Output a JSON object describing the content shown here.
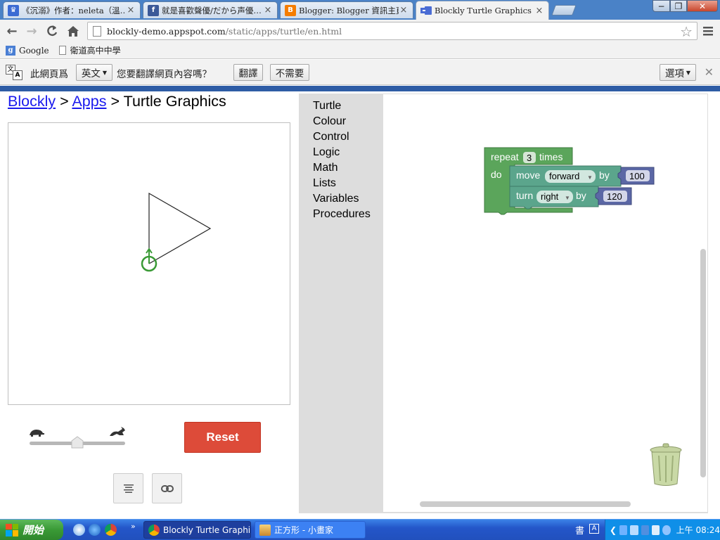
{
  "browser": {
    "tabs": [
      {
        "title": "《沉溺》作者：neleta（溫…",
        "icon": "ts-icon",
        "color": "#3b6bd3"
      },
      {
        "title": "就是喜歡聲優/だから声優…",
        "icon": "facebook-icon",
        "color": "#3b5998"
      },
      {
        "title": "Blogger: Blogger 資訊主頁",
        "icon": "blogger-icon",
        "color": "#f57d00"
      },
      {
        "title": "Blockly Turtle Graphics",
        "icon": "blockly-icon",
        "color": "#4a6cd4"
      }
    ],
    "window_controls": {
      "minimize": "−",
      "restore": "❐",
      "close": "✕"
    },
    "url_host": "blockly-demo.appspot.com",
    "url_path": "/static/apps/turtle/en.html",
    "bookmarks": [
      {
        "label": "Google",
        "icon": "google-icon"
      },
      {
        "label": "衛道高中中學",
        "icon": "page-icon"
      }
    ],
    "translate_bar": {
      "prefix": "此網頁爲",
      "language": "英文",
      "question": "您要翻譯網頁內容嗎？",
      "translate_button": "翻譯",
      "nope_button": "不需要",
      "options_button": "選項"
    }
  },
  "page": {
    "breadcrumb": {
      "blockly": "Blockly",
      "sep1": ">",
      "apps": "Apps",
      "sep2": ">",
      "current": "Turtle Graphics"
    },
    "reset_label": "Reset",
    "reset_color": "#dd4b39",
    "speed": {
      "value": 0.5
    }
  },
  "toolbox": [
    "Turtle",
    "Colour",
    "Control",
    "Logic",
    "Math",
    "Lists",
    "Variables",
    "Procedures"
  ],
  "blocks": {
    "repeat_word": "repeat",
    "repeat_count": "3",
    "times_word": "times",
    "do_word": "do",
    "move_word": "move",
    "move_dir": "forward",
    "by_word": "by",
    "move_value": "100",
    "turn_word": "turn",
    "turn_dir": "right",
    "turn_value": "120",
    "control_color": "#5ba55b",
    "turtle_color": "#5ba58c",
    "math_color": "#5b67a5"
  },
  "taskbar": {
    "start_label": "開始",
    "items": [
      {
        "label": "Blockly Turtle Graphi...",
        "state": "active"
      },
      {
        "label": "正方形 - 小畫家",
        "state": "inactive"
      }
    ],
    "ime": "書",
    "ime_mode": "A",
    "clock": "上午 08:24"
  }
}
